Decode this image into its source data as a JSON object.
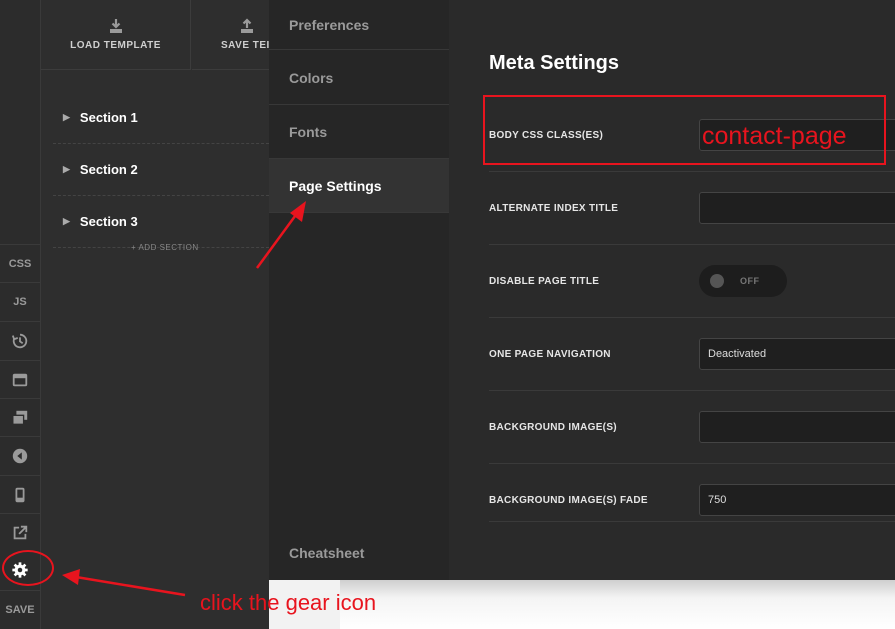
{
  "rail": {
    "css_label": "CSS",
    "js_label": "JS",
    "save_label": "SAVE",
    "icons": [
      "history-icon",
      "layout-icon",
      "pages-icon",
      "back-icon",
      "mobile-icon",
      "external-link-icon",
      "gear-icon"
    ]
  },
  "sections_panel": {
    "load_template_label": "LOAD TEMPLATE",
    "save_template_label": "SAVE TEI",
    "sections": [
      "Section 1",
      "Section 2",
      "Section 3"
    ],
    "add_section_label": "+ ADD SECTION"
  },
  "settings_nav": {
    "items": [
      {
        "label": "Preferences",
        "active": false
      },
      {
        "label": "Colors",
        "active": false
      },
      {
        "label": "Fonts",
        "active": false
      },
      {
        "label": "Page Settings",
        "active": true
      }
    ],
    "cheatsheet_label": "Cheatsheet"
  },
  "meta_settings": {
    "title": "Meta Settings",
    "rows": [
      {
        "label": "BODY CSS CLASS(ES)",
        "type": "input",
        "value": ""
      },
      {
        "label": "ALTERNATE INDEX TITLE",
        "type": "input",
        "value": ""
      },
      {
        "label": "DISABLE PAGE TITLE",
        "type": "toggle",
        "value": "OFF"
      },
      {
        "label": "ONE PAGE NAVIGATION",
        "type": "select",
        "value": "Deactivated"
      },
      {
        "label": "BACKGROUND IMAGE(S)",
        "type": "input",
        "value": ""
      },
      {
        "label": "BACKGROUND IMAGE(S) FADE",
        "type": "input",
        "value": "750"
      }
    ]
  },
  "annotations": {
    "css_class_text": "contact-page",
    "instruction_text": "click the gear icon",
    "color": "#e8141e"
  }
}
